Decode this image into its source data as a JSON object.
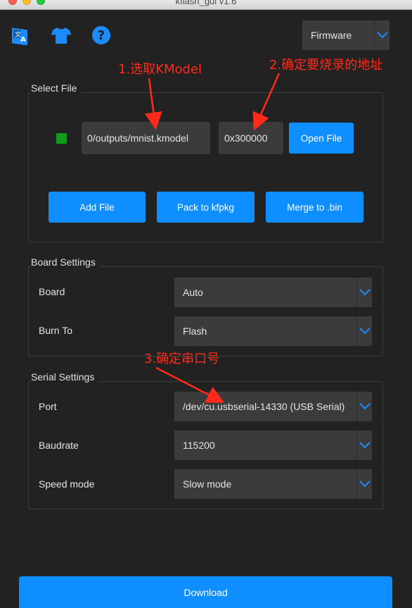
{
  "window": {
    "title": "kflash_gui v1.6"
  },
  "toolbar": {
    "firmware_select": "Firmware"
  },
  "annotations": {
    "step1": "1.选取KModel",
    "step2": "2.确定要烧录的地址",
    "step3": "3.确定串口号"
  },
  "select_file": {
    "title": "Select File",
    "status_color": "#109b1d",
    "file_path": "0/outputs/mnist.kmodel",
    "address": "0x300000",
    "open_file": "Open File",
    "add_file": "Add File",
    "pack": "Pack to kfpkg",
    "merge": "Merge to .bin"
  },
  "board_settings": {
    "title": "Board Settings",
    "board_label": "Board",
    "board_value": "Auto",
    "burn_label": "Burn To",
    "burn_value": "Flash"
  },
  "serial_settings": {
    "title": "Serial Settings",
    "port_label": "Port",
    "port_value": "/dev/cu.usbserial-14330 (USB Serial)",
    "baud_label": "Baudrate",
    "baud_value": "115200",
    "speed_label": "Speed mode",
    "speed_value": "Slow mode"
  },
  "download": {
    "label": "Download"
  },
  "colors": {
    "accent": "#0f8fff",
    "background": "#222222",
    "annotation": "#ff2a1a"
  }
}
